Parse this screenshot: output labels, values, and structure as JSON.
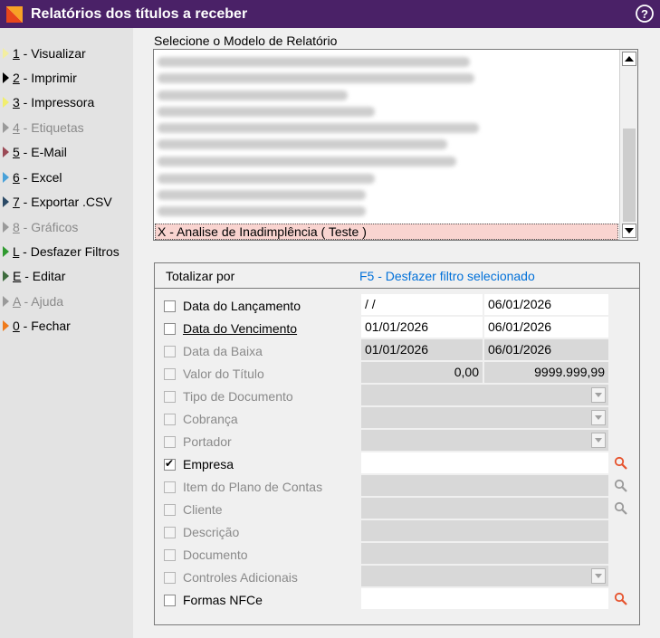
{
  "window": {
    "title": "Relatórios dos títulos a receber",
    "icons": {
      "app": "report-icon",
      "help": "help-icon"
    }
  },
  "sidebar": {
    "items": [
      {
        "key": "1",
        "text": " - Visualizar",
        "color": "#f3eea0",
        "enabled": true
      },
      {
        "key": "2",
        "text": " - Imprimir",
        "color": "#000000",
        "enabled": true
      },
      {
        "key": "3",
        "text": " - Impressora",
        "color": "#f1ee6e",
        "enabled": true
      },
      {
        "key": "4",
        "text": " - Etiquetas",
        "color": "#9a9a9a",
        "enabled": false
      },
      {
        "key": "5",
        "text": " - E-Mail",
        "color": "#9b4a56",
        "enabled": true
      },
      {
        "key": "6",
        "text": " - Excel",
        "color": "#48a1d9",
        "enabled": true
      },
      {
        "key": "7",
        "text": " - Exportar .CSV",
        "color": "#2b4a66",
        "enabled": true
      },
      {
        "key": "8",
        "text": " - Gráficos",
        "color": "#9a9a9a",
        "enabled": false
      },
      {
        "key": "L",
        "text": " - Desfazer Filtros",
        "color": "#2f9a2f",
        "enabled": true
      },
      {
        "key": "E",
        "text": " - Editar",
        "color": "#3d6b3d",
        "enabled": true
      },
      {
        "key": "A",
        "text": " - Ajuda",
        "color": "#9a9a9a",
        "enabled": false
      },
      {
        "key": "0",
        "text": " - Fechar",
        "color": "#ef7a1a",
        "enabled": true
      }
    ]
  },
  "report_list": {
    "label": "Selecione o Modelo de Relatório",
    "selected": "X - Analise de Inadimplência ( Teste )"
  },
  "filters": {
    "header": "Totalizar por",
    "undo_link": "F5 - Desfazer filtro selecionado",
    "rows": [
      {
        "label": "Data do Lançamento",
        "checked": false,
        "enabled": true,
        "from": " / /",
        "to": "06/01/2026"
      },
      {
        "label": "Data do Vencimento",
        "checked": false,
        "enabled": true,
        "from": "01/01/2026",
        "to": "06/01/2026"
      },
      {
        "label": "Data da Baixa",
        "checked": false,
        "enabled": false,
        "from": "01/01/2026",
        "to": "06/01/2026"
      },
      {
        "label": "Valor do Título",
        "checked": false,
        "enabled": false,
        "from": "0,00",
        "to": "9999.999,99"
      },
      {
        "label": "Tipo de Documento",
        "checked": false,
        "enabled": false
      },
      {
        "label": "Cobrança",
        "checked": false,
        "enabled": false
      },
      {
        "label": "Portador",
        "checked": false,
        "enabled": false
      },
      {
        "label": "Empresa",
        "checked": true,
        "enabled": true
      },
      {
        "label": "Item do Plano de Contas",
        "checked": false,
        "enabled": false
      },
      {
        "label": "Cliente",
        "checked": false,
        "enabled": false
      },
      {
        "label": "Descrição",
        "checked": false,
        "enabled": false
      },
      {
        "label": "Documento",
        "checked": false,
        "enabled": false
      },
      {
        "label": "Controles Adicionais",
        "checked": false,
        "enabled": false
      },
      {
        "label": "Formas NFCe",
        "checked": false,
        "enabled": true
      }
    ]
  },
  "colors": {
    "title_bar": "#4a2167",
    "link": "#0070d9",
    "selected_row": "#f9d4d0",
    "search_active": "#e6522c",
    "search_disabled": "#9a9a9a"
  }
}
